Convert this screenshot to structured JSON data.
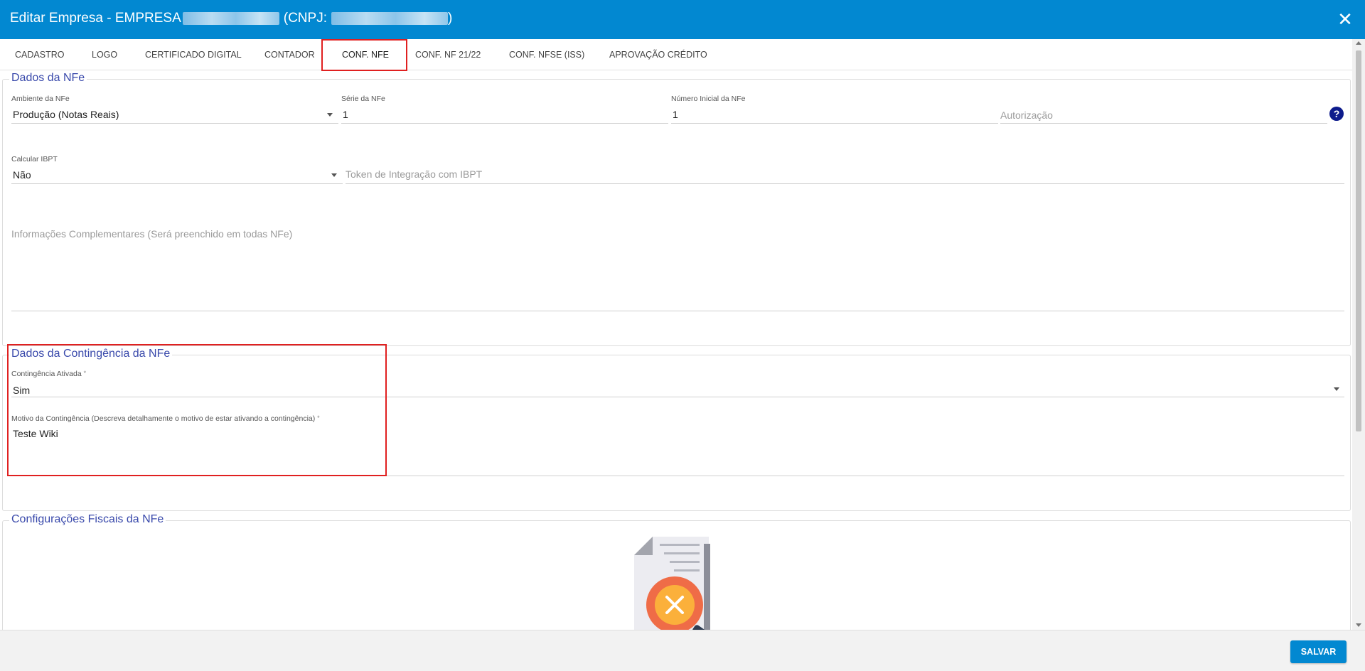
{
  "window": {
    "title_prefix": "Editar Empresa - EMPRESA",
    "title_middle": "(CNPJ:",
    "title_suffix": ")",
    "close_icon": "close-icon"
  },
  "tabs": [
    {
      "label": "CADASTRO"
    },
    {
      "label": "LOGO"
    },
    {
      "label": "CERTIFICADO DIGITAL"
    },
    {
      "label": "CONTADOR"
    },
    {
      "label": "CONF. NFE"
    },
    {
      "label": "CONF. NF 21/22"
    },
    {
      "label": "CONF. NFSE (ISS)"
    },
    {
      "label": "APROVAÇÃO CRÉDITO"
    }
  ],
  "active_tab": "CONF. NFE",
  "dados_nfe": {
    "legend": "Dados da NFe",
    "ambiente": {
      "label": "Ambiente da NFe",
      "value": "Produção (Notas Reais)"
    },
    "serie": {
      "label": "Série da NFe",
      "value": "1"
    },
    "numero_inicial": {
      "label": "Número Inicial da NFe",
      "value": "1"
    },
    "autorizacao": {
      "placeholder": "Autorização"
    },
    "calcular_ibpt": {
      "label": "Calcular IBPT",
      "value": "Não"
    },
    "token_ibpt": {
      "placeholder": "Token de Integração com IBPT"
    },
    "info_complementares": {
      "placeholder": "Informações Complementares (Será preenchido em todas NFe)"
    }
  },
  "contingencia": {
    "legend": "Dados da Contingência da NFe",
    "ativada": {
      "label": "Contingência Ativada",
      "required": "*",
      "value": "Sim"
    },
    "motivo": {
      "label": "Motivo da Contingência (Descreva detalhamente o motivo de estar ativando a contingência)",
      "required": "*",
      "value": "Teste Wiki"
    }
  },
  "fiscais": {
    "legend": "Configurações Fiscais da NFe"
  },
  "footer": {
    "save_label": "SALVAR"
  },
  "colors": {
    "brand": "#0288d1",
    "legend": "#3949ab",
    "highlight": "#e02020"
  }
}
